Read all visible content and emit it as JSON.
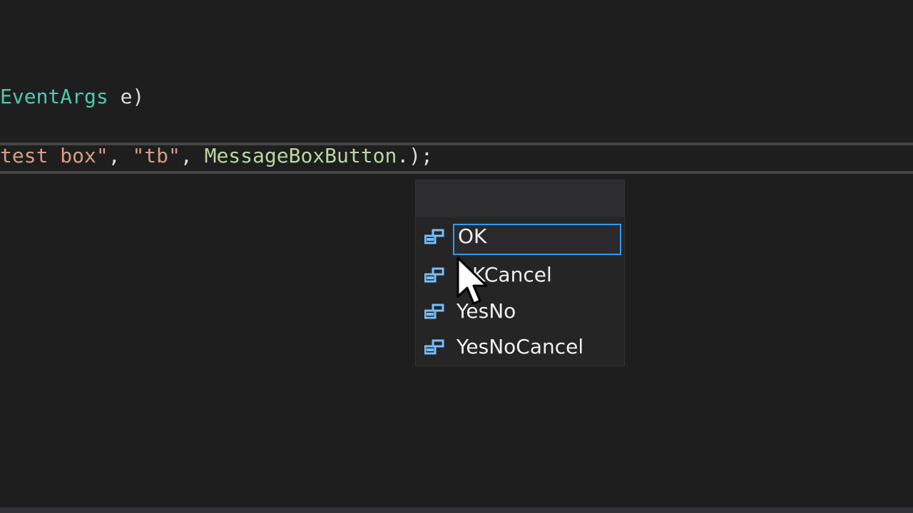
{
  "editor": {
    "line1": {
      "type_name": "EventArgs",
      "rest": " e)"
    },
    "line2": {
      "string1": "test box\"",
      "sep1": ", ",
      "string2": "\"tb\"",
      "sep2": ", ",
      "class_name": "MessageBoxButton",
      "rest": ".);"
    }
  },
  "completion_list": {
    "items": [
      {
        "label": "OK",
        "icon": "enum-member-icon",
        "selected": true
      },
      {
        "label": "OKCancel",
        "icon": "enum-member-icon",
        "selected": false
      },
      {
        "label": "YesNo",
        "icon": "enum-member-icon",
        "selected": false
      },
      {
        "label": "YesNoCancel",
        "icon": "enum-member-icon",
        "selected": false
      }
    ]
  },
  "colors": {
    "background": "#1e1e1e",
    "type": "#4ec9b0",
    "string": "#d69d85",
    "class": "#b8d7a3",
    "selection_border": "#3399ff",
    "icon": "#75beff"
  }
}
